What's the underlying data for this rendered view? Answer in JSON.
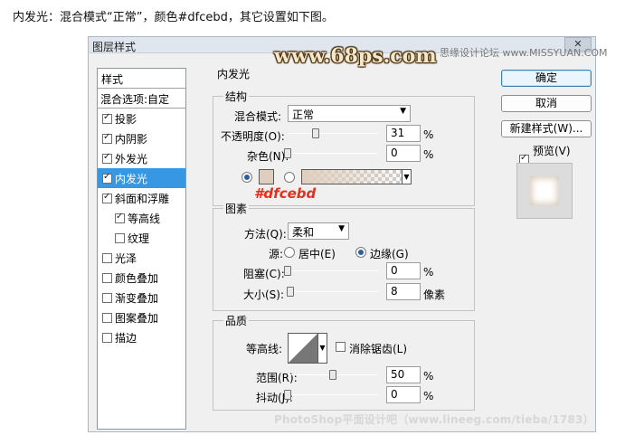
{
  "caption": "内发光：混合模式“正常”，颜色#dfcebd，其它设置如下图。",
  "window": {
    "title": "图层样式",
    "close_label": "✕"
  },
  "watermarks": {
    "top_logo": "www.68ps.com",
    "top_site": "思缘设计论坛 www.MISSYUAN.COM",
    "footer": "PhotoShop平面设计吧（www.lineeg.com/tieba/1783）"
  },
  "annotation": "#dfcebd",
  "styles_panel": {
    "header": "样式",
    "blend_options": "混合选项:自定",
    "items": [
      {
        "label": "投影",
        "checked": true
      },
      {
        "label": "内阴影",
        "checked": true
      },
      {
        "label": "外发光",
        "checked": true
      },
      {
        "label": "内发光",
        "checked": true,
        "selected": true
      },
      {
        "label": "斜面和浮雕",
        "checked": true
      },
      {
        "label": "等高线",
        "checked": true,
        "indent": true
      },
      {
        "label": "纹理",
        "checked": false,
        "indent": true
      },
      {
        "label": "光泽",
        "checked": false
      },
      {
        "label": "颜色叠加",
        "checked": false
      },
      {
        "label": "渐变叠加",
        "checked": false
      },
      {
        "label": "图案叠加",
        "checked": false
      },
      {
        "label": "描边",
        "checked": false
      }
    ]
  },
  "inner_glow": {
    "section_title": "内发光",
    "structure": {
      "title": "结构",
      "blend_mode_label": "混合模式:",
      "blend_mode_value": "正常",
      "opacity_label": "不透明度(O):",
      "opacity_value": "31",
      "opacity_unit": "%",
      "noise_label": "杂色(N):",
      "noise_value": "0",
      "noise_unit": "%",
      "color": "#dfcebd",
      "use_color": true
    },
    "elements": {
      "title": "图素",
      "technique_label": "方法(Q):",
      "technique_value": "柔和",
      "source_label": "源:",
      "source_center": "居中(E)",
      "source_edge": "边缘(G)",
      "source_selected": "edge",
      "choke_label": "阻塞(C):",
      "choke_value": "0",
      "choke_unit": "%",
      "size_label": "大小(S):",
      "size_value": "8",
      "size_unit": "像素"
    },
    "quality": {
      "title": "品质",
      "contour_label": "等高线:",
      "antialias_label": "消除锯齿(L)",
      "antialias_checked": false,
      "range_label": "范围(R):",
      "range_value": "50",
      "range_unit": "%",
      "jitter_label": "抖动(J):",
      "jitter_value": "0",
      "jitter_unit": "%"
    }
  },
  "buttons": {
    "ok": "确定",
    "cancel": "取消",
    "new_style": "新建样式(W)...",
    "preview_label": "预览(V)",
    "preview_checked": true
  }
}
